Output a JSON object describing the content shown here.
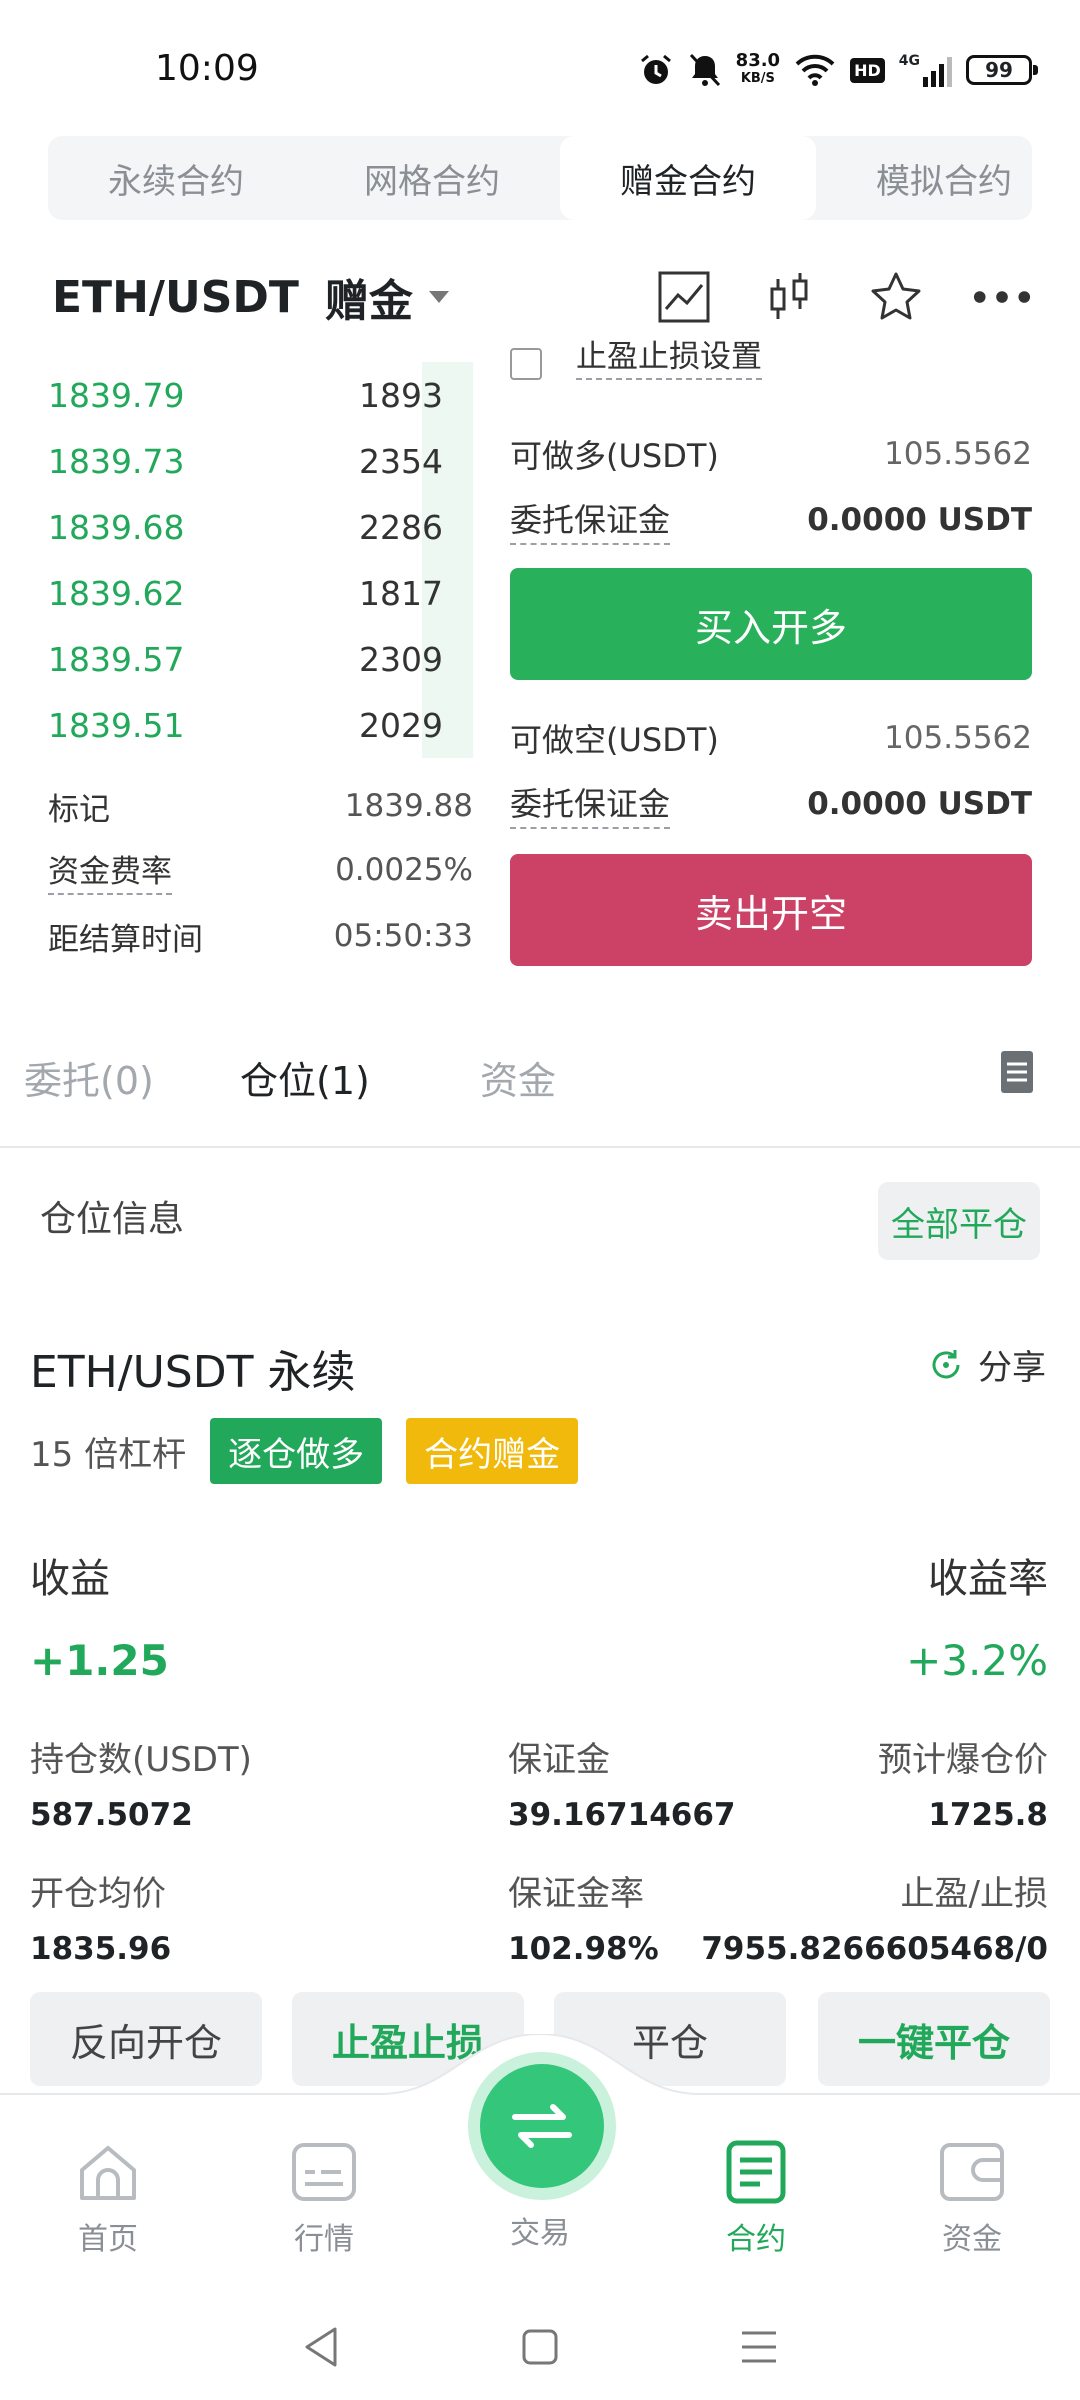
{
  "status_bar": {
    "time": "10:09",
    "speed_top": "83.0",
    "speed_unit": "KB/S",
    "hd": "HD",
    "network": "4G",
    "battery": "99"
  },
  "contract_tabs": [
    "永续合约",
    "网格合约",
    "赠金合约",
    "模拟合约"
  ],
  "header": {
    "pair": "ETH/USDT",
    "tag": "赠金"
  },
  "orderbook": {
    "rows": [
      {
        "price": "1839.79",
        "qty": "1893",
        "depth": 0.12
      },
      {
        "price": "1839.73",
        "qty": "2354",
        "depth": 0.12
      },
      {
        "price": "1839.68",
        "qty": "2286",
        "depth": 0.12
      },
      {
        "price": "1839.62",
        "qty": "1817",
        "depth": 0.12
      },
      {
        "price": "1839.57",
        "qty": "2309",
        "depth": 0.12
      },
      {
        "price": "1839.51",
        "qty": "2029",
        "depth": 0.12
      }
    ],
    "mark_label": "标记",
    "mark_value": "1839.88",
    "funding_label": "资金费率",
    "funding_value": "0.0025%",
    "settle_label": "距结算时间",
    "settle_value": "05:50:33"
  },
  "order_panel": {
    "tp_sl_label": "止盈止损设置",
    "long_avail_label": "可做多(USDT)",
    "long_avail_value": "105.5562",
    "margin_label": "委托保证金",
    "margin_value": "0.0000 USDT",
    "buy_label": "买入开多",
    "short_avail_label": "可做空(USDT)",
    "short_avail_value": "105.5562",
    "margin_label_2": "委托保证金",
    "margin_value_2": "0.0000 USDT",
    "sell_label": "卖出开空"
  },
  "position_tabs": [
    "委托(0)",
    "仓位(1)",
    "资金"
  ],
  "position": {
    "section_title": "仓位信息",
    "close_all": "全部平仓",
    "symbol": "ETH/USDT 永续",
    "share": "分享",
    "leverage": "15 倍杠杆",
    "badge_side": "逐仓做多",
    "badge_bonus": "合约赠金",
    "pnl_label": "收益",
    "pnl_value": "+1.25",
    "roe_label": "收益率",
    "roe_value": "+3.2%",
    "size_label": "持仓数(USDT)",
    "size_value": "587.5072",
    "margin_label": "保证金",
    "margin_value": "39.16714667",
    "liq_label": "预计爆仓价",
    "liq_value": "1725.8",
    "entry_label": "开仓均价",
    "entry_value": "1835.96",
    "margin_ratio_label": "保证金率",
    "margin_ratio_value": "102.98%",
    "tpsl_label": "止盈/止损",
    "tpsl_value": "7955.8266605468/0"
  },
  "actions": [
    "反向开仓",
    "止盈止损",
    "平仓",
    "一键平仓"
  ],
  "bottom_nav": [
    "首页",
    "行情",
    "交易",
    "合约",
    "资金"
  ],
  "colors": {
    "green": "#22a85a",
    "red": "#cc4166",
    "yellow": "#f0b90b"
  }
}
